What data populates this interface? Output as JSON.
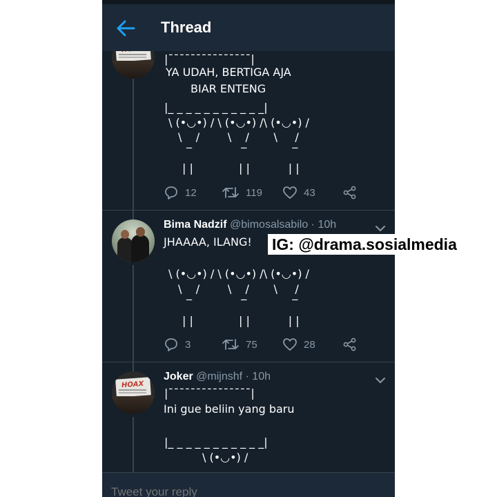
{
  "header": {
    "title": "Thread",
    "back_icon": "arrow-left-icon",
    "accent": "#1da1f2"
  },
  "colors": {
    "background": "#15202b",
    "header": "#1c2938",
    "secondary_text": "#8899a6",
    "divider": "#38444d"
  },
  "tweets": [
    {
      "body": [
        "|¯¯¯¯¯¯¯¯¯¯¯¯¯¯¯|",
        "YA UDAH, BERTIGA AJA",
        "BIAR ENTENG",
        "|_ _ _ _ _ _ _ _ _ _ _|",
        "\\ (•◡•) / \\ (•◡•) /\\ (•◡•) /",
        "\\    /        \\    /       \\     /",
        "‾              ‾             ‾",
        "| |             | |           | |"
      ],
      "replies": "12",
      "retweets": "119",
      "likes": "43"
    },
    {
      "name": "Bima Nadzif",
      "handle": "@bimosalsabilo",
      "time": "· 10h",
      "body": [
        "JHAAAA, ILANG!",
        "\\ (•◡•) / \\ (•◡•) /\\ (•◡•) /",
        "\\    /        \\    /       \\     /",
        "‾              ‾             ‾",
        "| |             | |           | |"
      ],
      "replies": "3",
      "retweets": "75",
      "likes": "28"
    },
    {
      "name": "Joker",
      "handle": "@mijnshf",
      "time": "· 10h",
      "body": [
        "|¯¯¯¯¯¯¯¯¯¯¯¯¯¯¯|",
        "Ini gue beliin yang baru",
        "|_ _ _ _ _ _ _ _ _ _ _|",
        "\\ (•◡•) /"
      ]
    }
  ],
  "avatar_text": "HOAX",
  "reply": {
    "placeholder": "Tweet your reply"
  },
  "watermark": "IG: @drama.sosialmedia"
}
